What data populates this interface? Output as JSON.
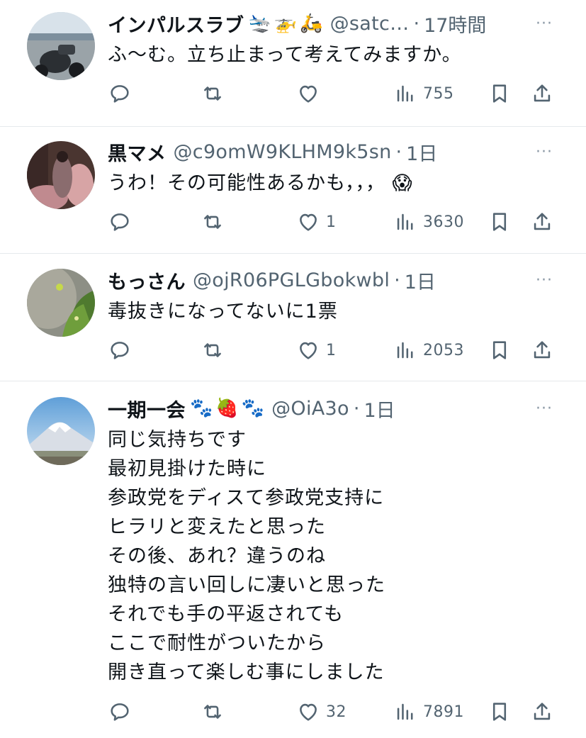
{
  "tweets": [
    {
      "name": "インパルスラブ",
      "badges": [
        "🛬",
        "🚁",
        "🛵"
      ],
      "handle": "@satc…",
      "time": "17時間",
      "more": "···",
      "lines": [
        "ふ〜む。立ち止まって考えてみますか。"
      ],
      "reply_count": "",
      "retweet_count": "",
      "like_count": "",
      "views": "755"
    },
    {
      "name": "黒マメ",
      "badges": [],
      "handle": "@c9omW9KLHM9k5sn",
      "time": "1日",
      "more": "···",
      "lines": [
        "うわ！その可能性あるかも，，，  😱"
      ],
      "reply_count": "",
      "retweet_count": "",
      "like_count": "1",
      "views": "3630"
    },
    {
      "name": "もっさん",
      "badges": [],
      "handle": "@ojR06PGLGbokwbl",
      "time": "1日",
      "more": "···",
      "lines": [
        "毒抜きになってないに1票"
      ],
      "reply_count": "",
      "retweet_count": "",
      "like_count": "1",
      "views": "2053"
    },
    {
      "name": "一期一会",
      "badges": [
        "🐾",
        "🍓",
        "🐾"
      ],
      "handle": "@OiA3o",
      "time": "1日",
      "more": "···",
      "lines": [
        "同じ気持ちです",
        "最初見掛けた時に",
        "参政党をディスて参政党支持に",
        "ヒラリと変えたと思った",
        "その後、あれ？違うのね",
        "独特の言い回しに凄いと思った",
        "それでも手の平返されても",
        "ここで耐性がついたから",
        "開き直って楽しむ事にしました"
      ],
      "reply_count": "",
      "retweet_count": "",
      "like_count": "32",
      "views": "7891"
    }
  ],
  "icons": {
    "reply": "reply-icon",
    "retweet": "retweet-icon",
    "like": "heart-icon",
    "views": "views-icon",
    "bookmark": "bookmark-icon",
    "share": "share-icon"
  },
  "colors": {
    "text": "#0f1419",
    "secondary": "#536471",
    "divider": "#e6e9ec"
  }
}
